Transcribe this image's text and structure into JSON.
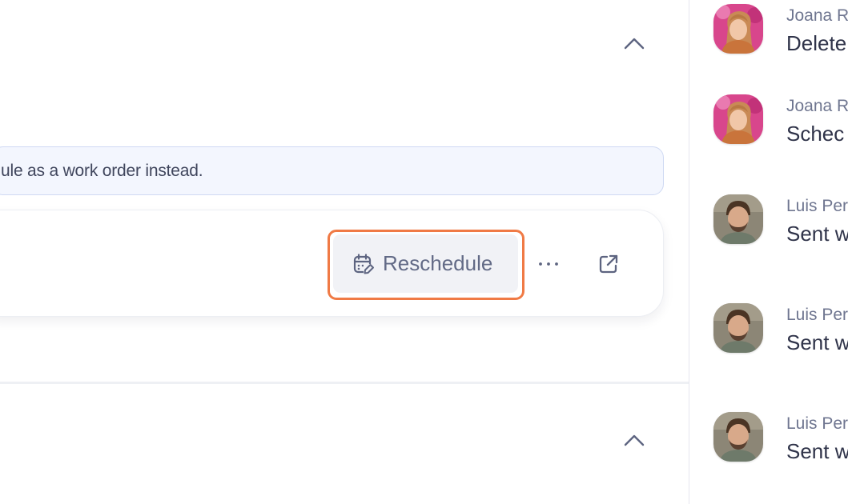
{
  "main": {
    "info_banner_text": "ule as a work order instead.",
    "reschedule_label": "Reschedule",
    "more_label": "···",
    "icons": {
      "collapse": "chevron-up-icon",
      "reschedule": "calendar-edit-icon",
      "more": "more-horizontal-icon",
      "external": "external-link-icon"
    },
    "highlight_color": "#f07a45"
  },
  "activity": {
    "items": [
      {
        "author": "Joana R",
        "text": "Delete",
        "avatar": "woman-avatar"
      },
      {
        "author": "Joana R",
        "text": "Schec",
        "avatar": "woman-avatar"
      },
      {
        "author": "Luis Per",
        "text": "Sent w",
        "avatar": "man-avatar"
      },
      {
        "author": "Luis Per",
        "text": "Sent w",
        "avatar": "man-avatar"
      },
      {
        "author": "Luis Per",
        "text": "Sent w",
        "avatar": "man-avatar"
      }
    ]
  }
}
